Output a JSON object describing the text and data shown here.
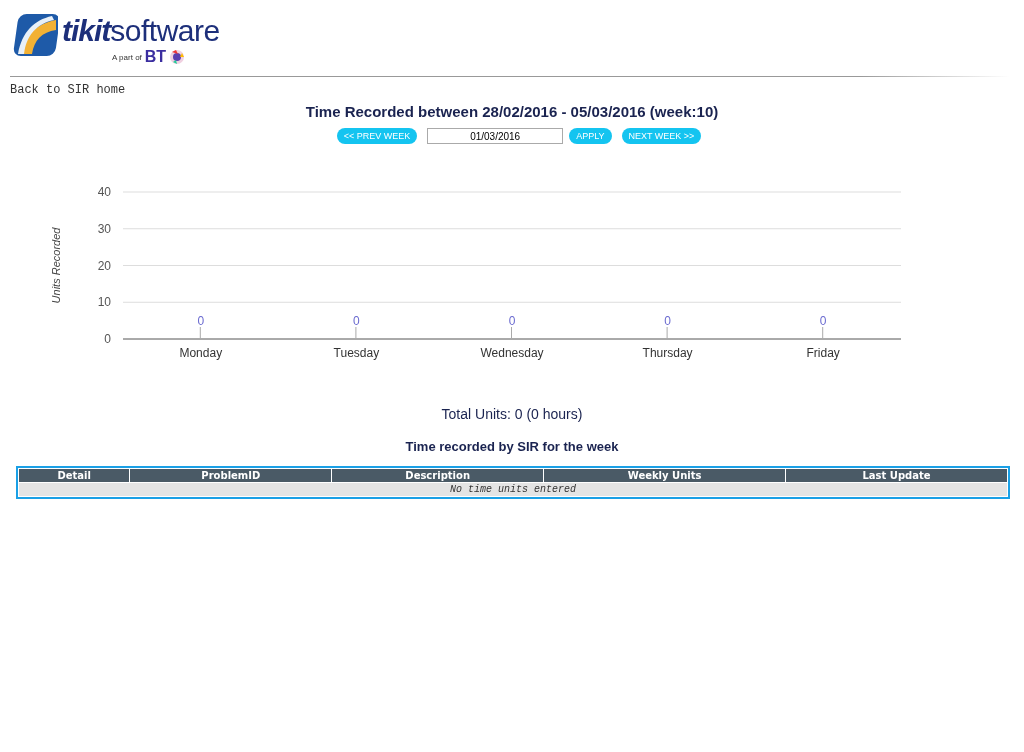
{
  "logo": {
    "brand_bold": "tikit",
    "brand_light": "software",
    "tagline": "A part of",
    "parent": "BT"
  },
  "back_link": "Back to SIR home",
  "title": "Time Recorded between 28/02/2016 - 05/03/2016 (week:10)",
  "week_nav": {
    "prev": "<< PREV WEEK",
    "date_value": "01/03/2016",
    "apply": "APPLY",
    "next": "NEXT WEEK >>"
  },
  "chart_data": {
    "type": "bar",
    "ylabel": "Units Recorded",
    "categories": [
      "Monday",
      "Tuesday",
      "Wednesday",
      "Thursday",
      "Friday"
    ],
    "values": [
      0,
      0,
      0,
      0,
      0
    ],
    "ylim": [
      0,
      40
    ],
    "grid": true,
    "yticks": [
      0,
      10,
      20,
      30,
      40
    ],
    "data_labels": true
  },
  "total": "Total Units: 0 (0 hours)",
  "table": {
    "title": "Time recorded by SIR for the week",
    "columns": [
      "Detail",
      "ProblemID",
      "Description",
      "Weekly Units",
      "Last Update"
    ],
    "empty_message": "No time units entered"
  }
}
